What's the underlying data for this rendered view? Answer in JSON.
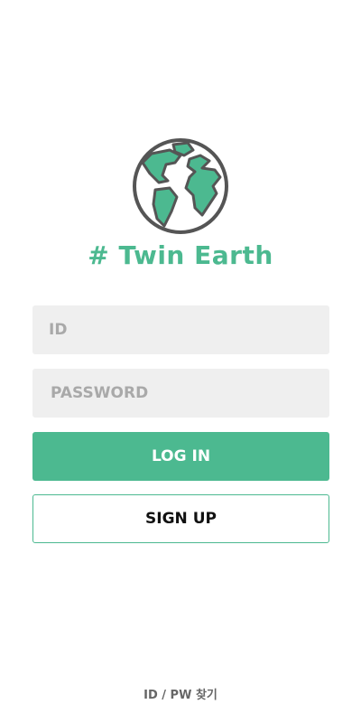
{
  "app": {
    "brand_name": "# Twin Earth",
    "logo_icon": "globe-icon",
    "colors": {
      "accent": "#4cb990",
      "field_bg": "#efefef",
      "placeholder": "#a9a9a9",
      "text_dark": "#111111",
      "link": "#666666"
    }
  },
  "login_form": {
    "id_placeholder": "ID",
    "id_value": "",
    "password_placeholder": "PASSWORD",
    "password_value": "",
    "login_label": "LOG IN",
    "signup_label": "SIGN UP"
  },
  "footer": {
    "find_account_label": "ID / PW 찾기"
  }
}
